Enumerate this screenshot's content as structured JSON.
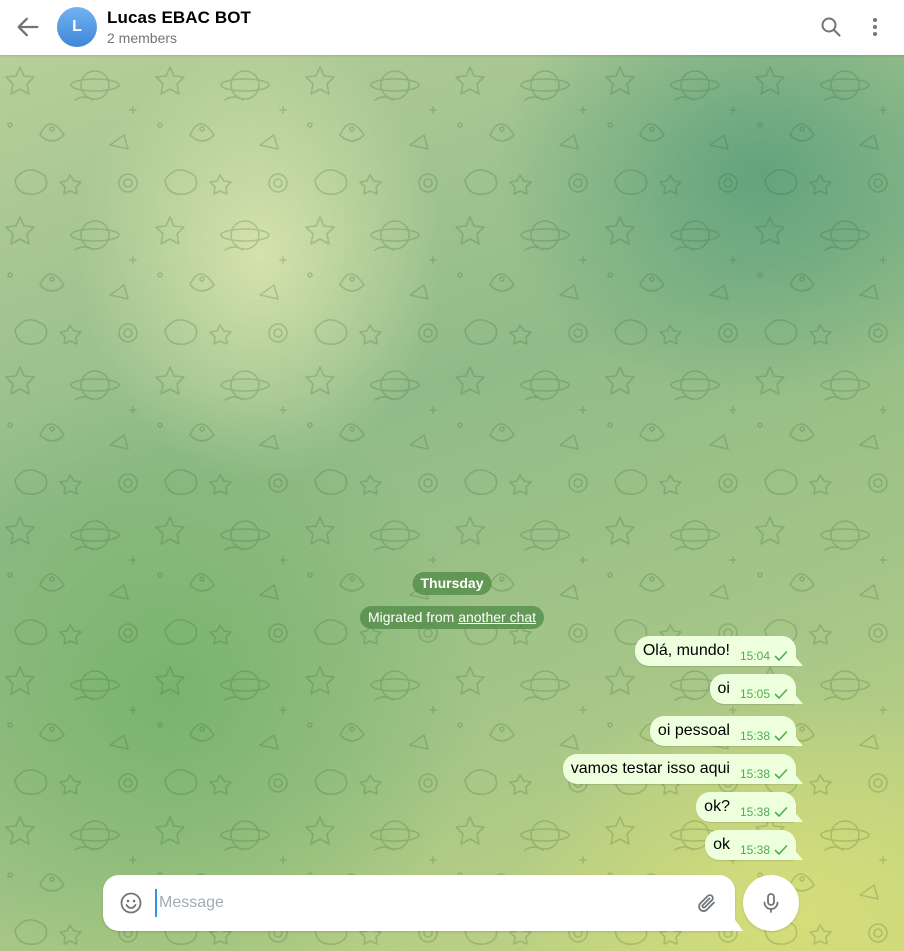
{
  "header": {
    "avatar_letter": "L",
    "title": "Lucas EBAC BOT",
    "subtitle": "2 members",
    "back_icon": "arrow-left-icon",
    "search_icon": "search-icon",
    "more_icon": "more-vertical-icon"
  },
  "service": {
    "date": "Thursday",
    "migrated_prefix": "Migrated from ",
    "migrated_link": "another chat"
  },
  "messages": [
    {
      "text": "Olá, mundo!",
      "time": "15:04"
    },
    {
      "text": "oi",
      "time": "15:05"
    },
    {
      "text": "oi pessoal",
      "time": "15:38"
    },
    {
      "text": "vamos testar isso aqui",
      "time": "15:38"
    },
    {
      "text": "ok?",
      "time": "15:38"
    },
    {
      "text": "ok",
      "time": "15:38"
    }
  ],
  "composer": {
    "placeholder": "Message",
    "emoji_icon": "smiley-icon",
    "attach_icon": "paperclip-icon",
    "mic_icon": "microphone-icon"
  },
  "colors": {
    "accent": "#3390ec",
    "outgoing_bubble": "#eeffde",
    "time_green": "#4fae4e",
    "service_pill": "#528c48"
  }
}
